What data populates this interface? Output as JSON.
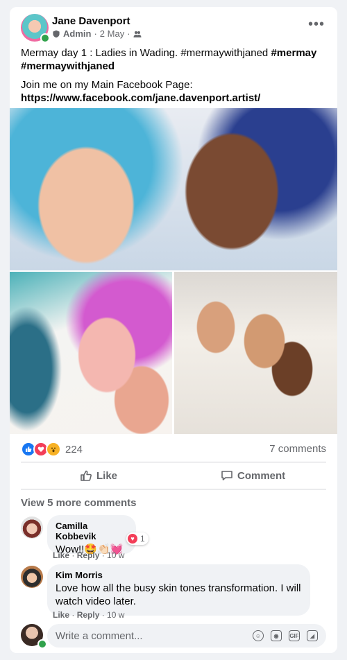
{
  "post": {
    "author": "Jane Davenport",
    "role": "Admin",
    "date": "2 May",
    "separator": "·",
    "more_icon": "more-horizontal-icon",
    "text_line1_plain": "Mermay  day 1 : Ladies in Wading. #mermaywithjaned ",
    "text_line1_bold": "#mermay",
    "text_line2_bold": "#mermaywithjaned",
    "text_join": "Join me on my Main Facebook Page:",
    "text_link": "https://www.facebook.com/jane.davenport.artist/"
  },
  "reactions": {
    "count": "224",
    "comments": "7 comments"
  },
  "actions": {
    "like": "Like",
    "comment": "Comment"
  },
  "comments_section": {
    "view_more": "View 5 more comments",
    "items": [
      {
        "name": "Camilla Kobbevik",
        "text": "Wow!!🤩👏🏻💓",
        "like": "Like",
        "reply": "Reply",
        "time": "10 w",
        "reaction_count": "1"
      },
      {
        "name": "Kim Morris",
        "text_line1": "Love how all the busy skin tones transformation. I will",
        "text_line2": "watch video later.",
        "like": "Like",
        "reply": "Reply",
        "time": "10 w"
      }
    ],
    "write_placeholder": "Write a comment..."
  },
  "colors": {
    "accent": "#1877f2",
    "love": "#f33e58",
    "wow": "#f7b125",
    "online": "#31a24c"
  }
}
